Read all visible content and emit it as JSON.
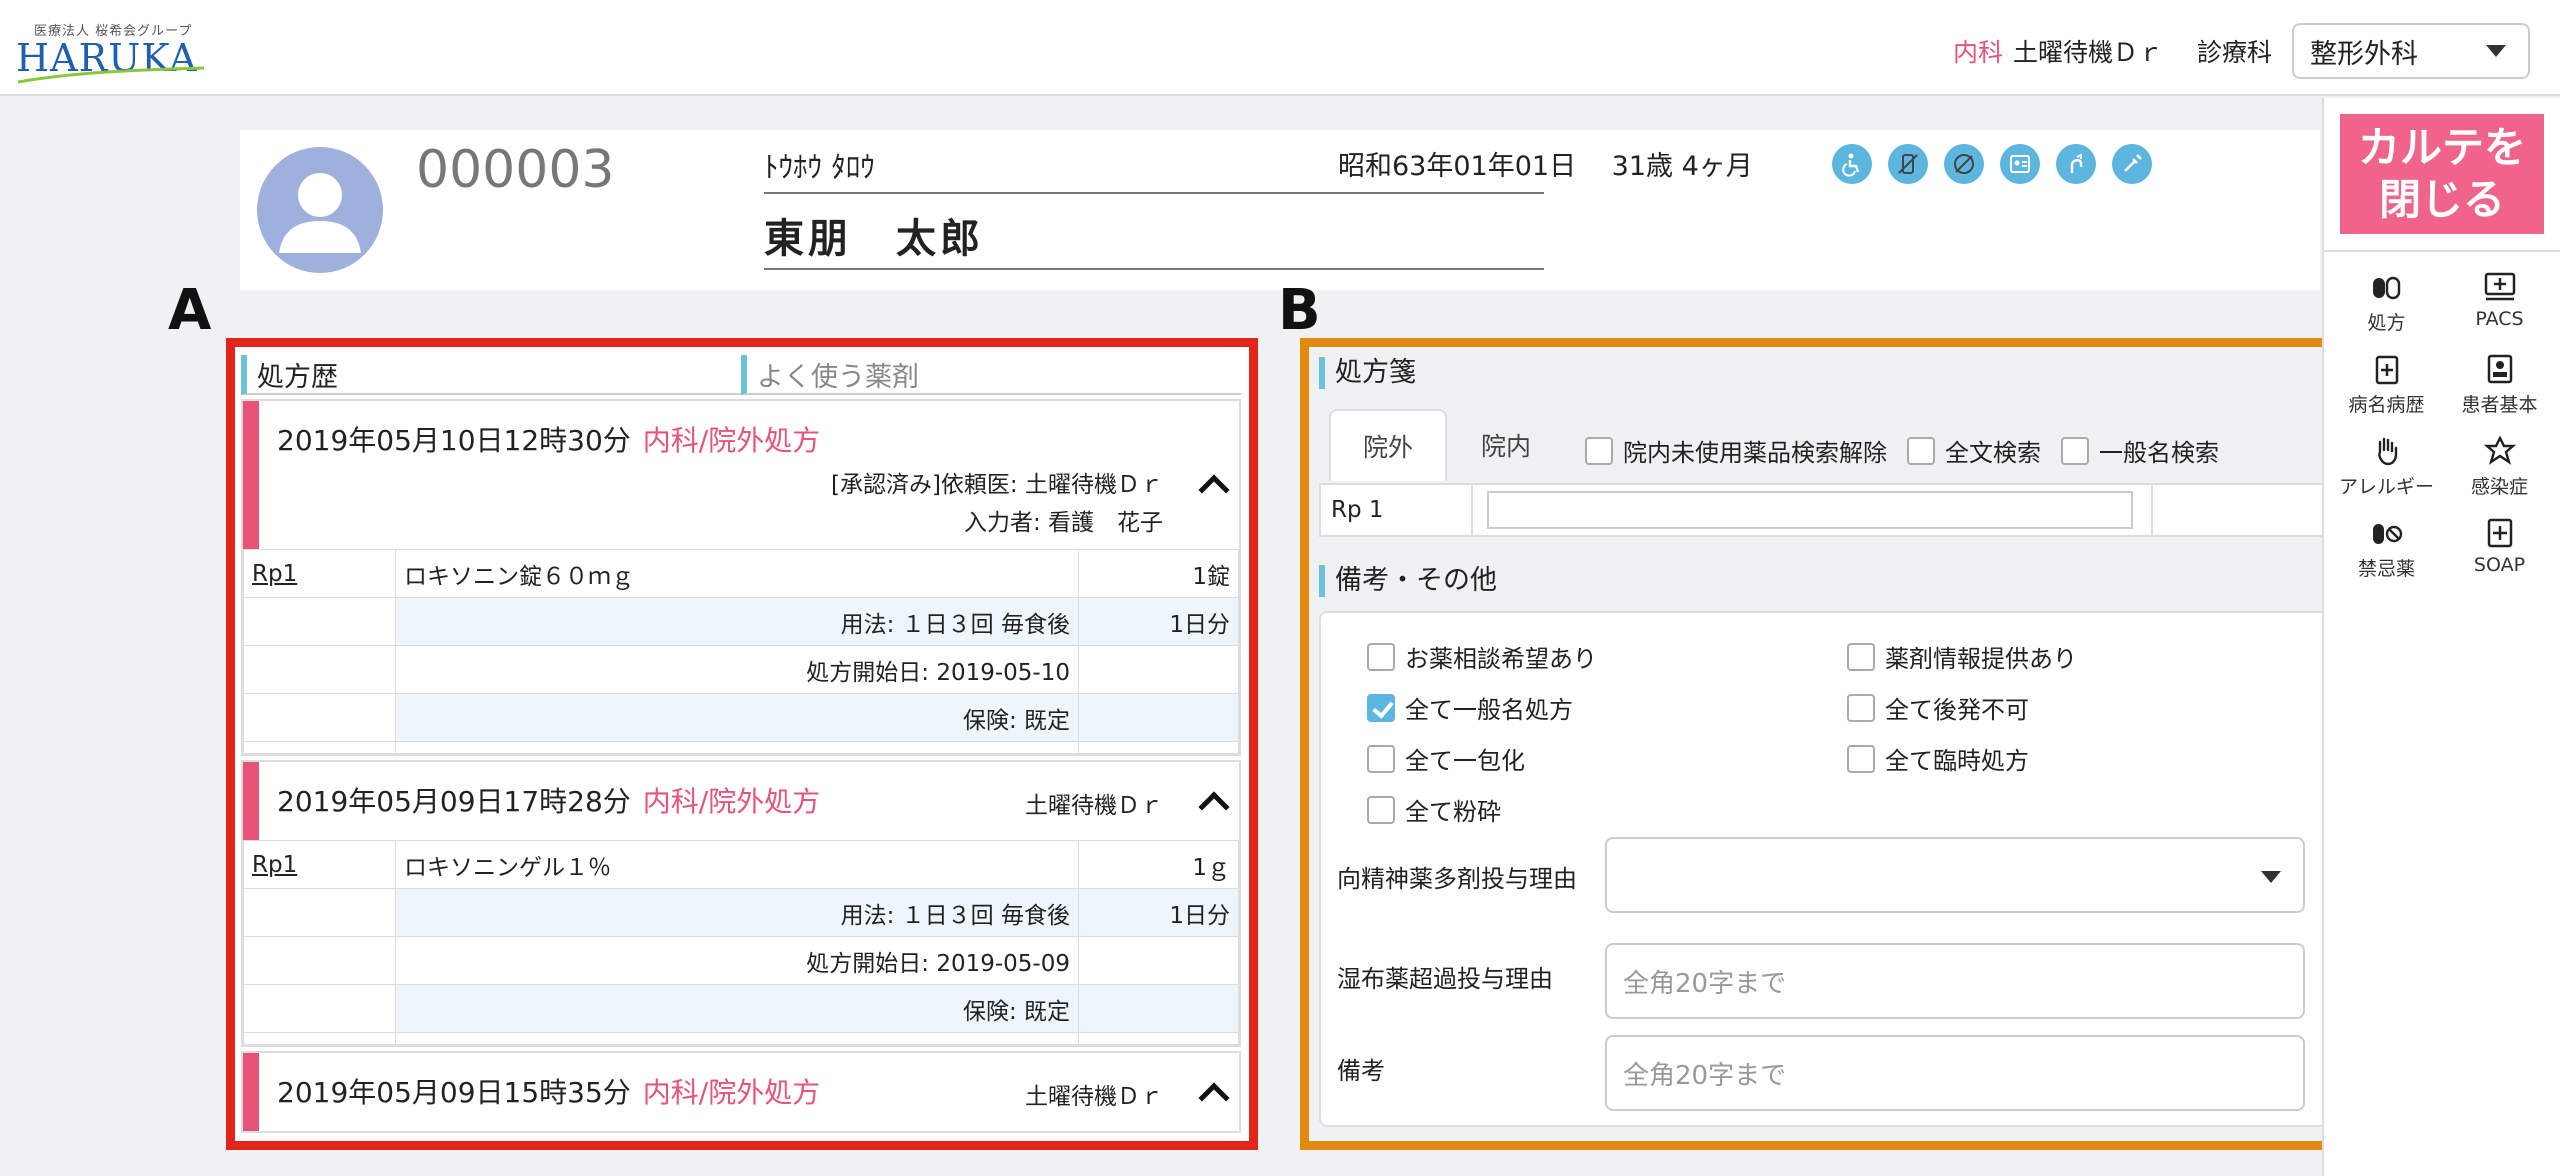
{
  "header": {
    "logo_small": "医療法人 桜希会グループ",
    "logo_main": "HARUKA",
    "dept": "内科",
    "doctor": "土曜待機Ｄｒ",
    "shinryo_label": "診療科",
    "dept_select_value": "整形外科"
  },
  "sidebar": {
    "close_label": "カルテを閉じる",
    "items": [
      {
        "label": "処方",
        "icon": "pills-icon"
      },
      {
        "label": "PACS",
        "icon": "monitor-plus-icon"
      },
      {
        "label": "病名病歴",
        "icon": "clipboard-plus-icon"
      },
      {
        "label": "患者基本",
        "icon": "id-card-icon"
      },
      {
        "label": "アレルギー",
        "icon": "hand-icon"
      },
      {
        "label": "感染症",
        "icon": "virus-icon"
      },
      {
        "label": "禁忌薬",
        "icon": "prohibited-pill-icon"
      },
      {
        "label": "SOAP",
        "icon": "doc-plus-icon"
      }
    ]
  },
  "patient": {
    "id": "000003",
    "kana": "ﾄｳﾎｳ ﾀﾛｳ",
    "name": "東朋　太郎",
    "dob_age": "昭和63年01年01日　 31歳 4ヶ月",
    "status_icons": [
      "wheelchair-icon",
      "no-food-icon",
      "no-meal-icon",
      "badge-icon",
      "walk-icon",
      "injection-icon"
    ],
    "status_color": "#5db6e0"
  },
  "labels": {
    "a": "A",
    "b": "B"
  },
  "panel_a": {
    "tab_history": "処方歴",
    "tab_frequent": "よく使う薬剤",
    "rx": [
      {
        "date": "2019年05月10日12時30分",
        "dept": "内科/院外処方",
        "meta1": "[承認済み]依頼医: 土曜待機Ｄｒ",
        "meta2": "入力者: 看護　花子",
        "rp": "Rp1",
        "drug": "ロキソニン錠６０ｍｇ",
        "qty": "1錠",
        "usage": "用法: １日３回 毎食後",
        "days": "1日分",
        "start": "処方開始日: 2019-05-10",
        "insurance": "保険: 既定"
      },
      {
        "date": "2019年05月09日17時28分",
        "dept": "内科/院外処方",
        "meta1": "土曜待機Ｄｒ",
        "rp": "Rp1",
        "drug": "ロキソニンゲル１％",
        "qty": "1ｇ",
        "usage": "用法: １日３回 毎食後",
        "days": "1日分",
        "start": "処方開始日: 2019-05-09",
        "insurance": "保険: 既定"
      },
      {
        "date": "2019年05月09日15時35分",
        "dept": "内科/院外処方",
        "meta1": "土曜待機Ｄｒ"
      }
    ],
    "accent": "#e8537a",
    "border_color": "#e1251b"
  },
  "panel_b": {
    "title": "処方箋",
    "tab_outside": "院外",
    "tab_inside": "院内",
    "opt_unused": "院内未使用薬品検索解除",
    "opt_fulltext": "全文検索",
    "opt_generic": "一般名検索",
    "rp_label": "Rp 1",
    "notes_title": "備考・その他",
    "checks": [
      {
        "label": "お薬相談希望あり",
        "checked": false
      },
      {
        "label": "薬剤情報提供あり",
        "checked": false
      },
      {
        "label": "全て一般名処方",
        "checked": true
      },
      {
        "label": "全て後発不可",
        "checked": false
      },
      {
        "label": "全て一包化",
        "checked": false
      },
      {
        "label": "全て臨時処方",
        "checked": false
      },
      {
        "label": "全て粉砕",
        "checked": false
      }
    ],
    "psych_label": "向精神薬多剤投与理由",
    "poultice_label": "湿布薬超過投与理由",
    "poultice_placeholder": "全角20字まで",
    "remarks_label": "備考",
    "remarks_placeholder": "全角20字まで",
    "border_color": "#e08a12"
  }
}
